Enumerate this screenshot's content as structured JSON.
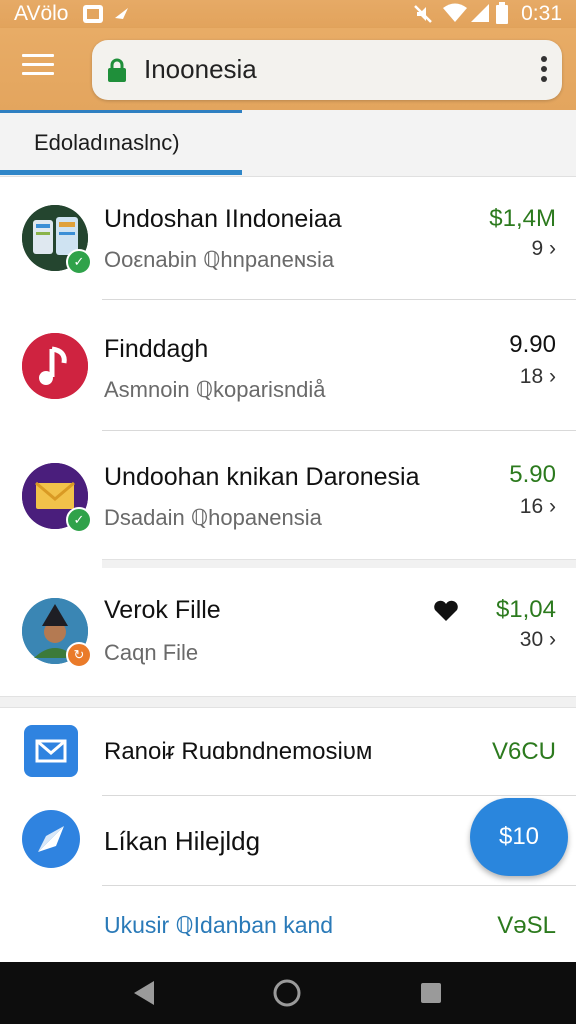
{
  "status": {
    "left_text": "AVölo",
    "time": "0:31",
    "icons": [
      "photo-icon",
      "send-icon",
      "mute-icon",
      "wifi-icon",
      "signal-icon",
      "battery-icon"
    ]
  },
  "toolbar": {
    "search_text": "Inoonesia"
  },
  "tab": {
    "label": "Edoladınaslnc)"
  },
  "items": [
    {
      "title": "Undoshan IIndoneiaa",
      "subtitle": "Ooεnabin ℚhnpaneɴsia",
      "price": "$1,4M",
      "count": "9",
      "price_color": "#2c7a1e",
      "avatar": "phones-icon",
      "badge": "check-icon"
    },
    {
      "title": "Finddagh",
      "subtitle": "Asmnoin ℚkoparisndiå",
      "price": "9.90",
      "count": "18",
      "price_color": "#111111",
      "avatar": "music-note-icon"
    },
    {
      "title": "Undoohan knikan Daronesia",
      "subtitle": "Dsadain ℚhopaɴensia",
      "price": "5.90",
      "count": "16",
      "price_color": "#2c7a1e",
      "avatar": "envelope-icon",
      "badge": "check-icon"
    },
    {
      "title": "Verok Fille",
      "subtitle": "Caɋn File",
      "price": "$1,04",
      "count": "30",
      "price_color": "#2c7a1e",
      "avatar": "person-photo-icon",
      "badge": "sync-icon"
    }
  ],
  "bottom_items": [
    {
      "title": "Ranoiᵲ Ruɑbndnemosiᴜᴍ",
      "value": "V6CU",
      "icon": "mail-icon"
    },
    {
      "title": "Líkan Hilejldg",
      "value": "",
      "icon": "compass-icon"
    },
    {
      "title": "Ukusir ℚIdanban kand",
      "value": "VəSL",
      "icon": ""
    }
  ],
  "fab": {
    "label": "$10"
  },
  "nav": {
    "back": "back-icon",
    "home": "home-icon",
    "recents": "recents-icon"
  },
  "colors": {
    "toolbar": "#e6a862",
    "accent": "#2a86dd",
    "price_green": "#2c7a1e"
  }
}
